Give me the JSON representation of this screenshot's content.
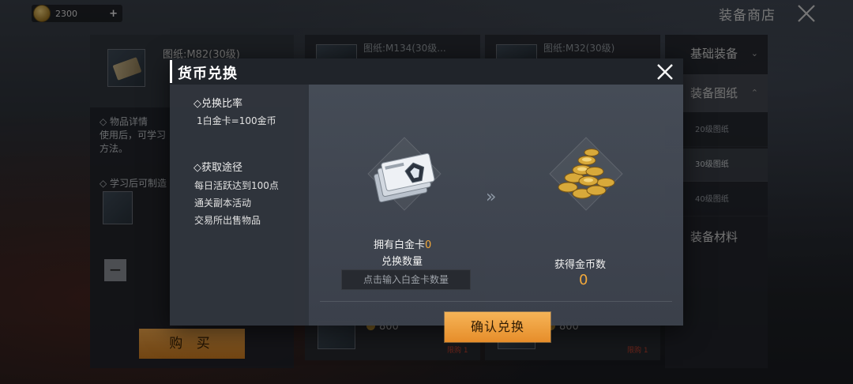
{
  "top": {
    "coins": "2300",
    "plus": "+",
    "shop_title": "装备商店"
  },
  "left_panel": {
    "item_title": "图纸:M82(30级)",
    "item_details_head": "◇ 物品详情",
    "item_details_text1": "使用后，可学习",
    "item_details_text2": "方法。",
    "learn_after": "◇ 学习后可制造",
    "qty_minus": "−",
    "buy_label": "购 买"
  },
  "grid": {
    "card1_title": "图纸:M134(30级...",
    "card2_title": "图纸:M32(30级)",
    "card_price": "800",
    "card_limit": "限购 1"
  },
  "right_nav": {
    "basic_equipment": "基础装备",
    "equipment_blueprints": "装备图纸",
    "level20": "20级图纸",
    "level30": "30级图纸",
    "level40": "40级图纸",
    "equipment_materials": "装备材料",
    "chev_down": "⌄",
    "chev_up": "⌃"
  },
  "modal": {
    "title": "货币兑换",
    "rate_head": "◇兑换比率",
    "rate_value": "1白金卡=100金币",
    "source_head": "◇获取途径",
    "source_1": "每日活跃达到100点",
    "source_2": "通关副本活动",
    "source_3": "交易所出售物品",
    "own_prefix": "拥有白金卡",
    "own_count": "0",
    "qty_label": "兑换数量",
    "qty_placeholder": "点击输入白金卡数量",
    "gain_label": "获得金币数",
    "gain_value": "0",
    "confirm": "确认兑换"
  },
  "colors": {
    "accent_orange": "#f3a93b",
    "button_orange": "#e68d2a"
  },
  "icons": [
    "coin-icon",
    "close-icon",
    "platinum-cards-icon",
    "gold-coins-icon",
    "double-arrow-icon"
  ]
}
